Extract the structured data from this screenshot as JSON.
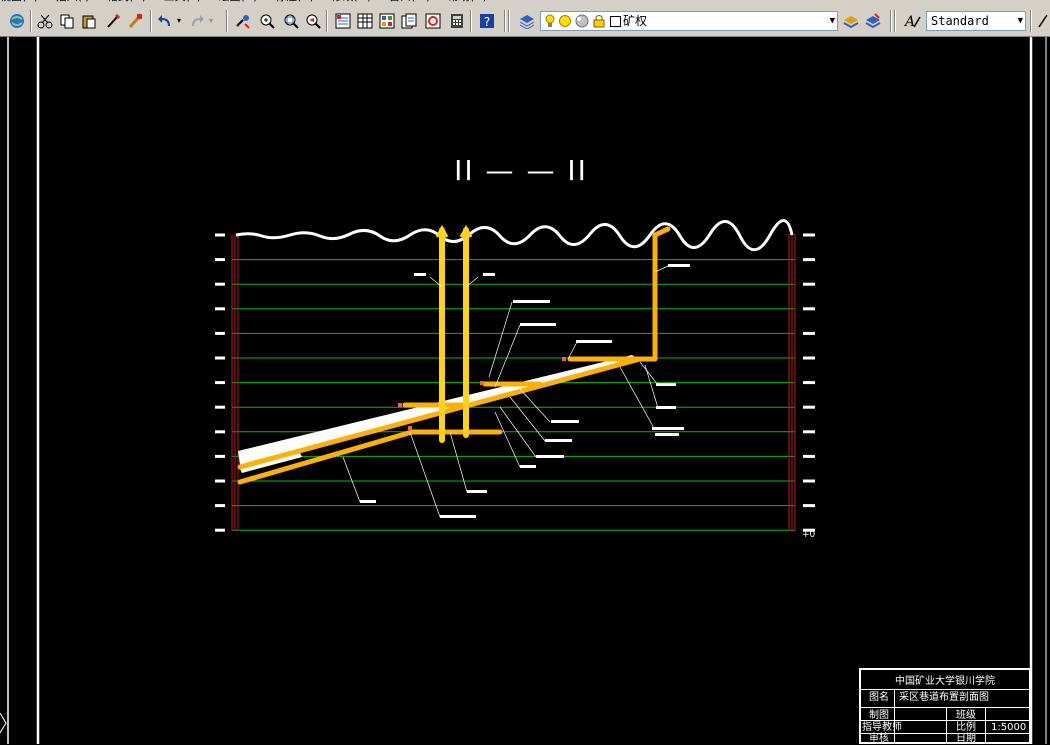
{
  "toolbar": {
    "layer_combo": {
      "value": "矿权",
      "arrow": "▼"
    },
    "textstyle_combo": {
      "value": "Standard",
      "arrow": "▼"
    },
    "icons": [
      "globe-icon",
      "cut-icon",
      "copy-icon",
      "paste-icon",
      "matchprop-icon",
      "brush-icon",
      "undo-icon",
      "redo-icon",
      "pan-icon",
      "zoom-realtime-icon",
      "zoom-window-icon",
      "zoom-previous-icon",
      "properties-icon",
      "design-center-icon",
      "tool-palettes-icon",
      "markup-icon",
      "calculator-icon",
      "help-icon",
      "layer-manager-icon",
      "lightbulb-icon",
      "sun-icon",
      "freeze-icon",
      "lock-icon",
      "color-swatch-icon",
      "layer-previous-icon",
      "layer-states-icon",
      "text-style-icon"
    ],
    "colors": {
      "face": "#d4d0c8",
      "lamp_yellow": "#ffe000"
    }
  },
  "drawing": {
    "section_title": "II — — II",
    "zero_label": "+0",
    "colors": {
      "grid": "#00c000",
      "roadway": "#ffb000",
      "seam": "#ffffff",
      "frame": "#ffffff",
      "wall": "#c01818",
      "shaft_yellow": "#ffd21a"
    }
  },
  "title_block": {
    "school": "中国矿业大学银川学院",
    "name_label": "图名",
    "name_value": "采区巷道布置剖面图",
    "drawn_label": "制图",
    "class_label": "班级",
    "advisor_label": "指导教师",
    "scale_label": "比例",
    "scale_value": "1:5000",
    "review_label": "审核",
    "date_label": "日期"
  }
}
